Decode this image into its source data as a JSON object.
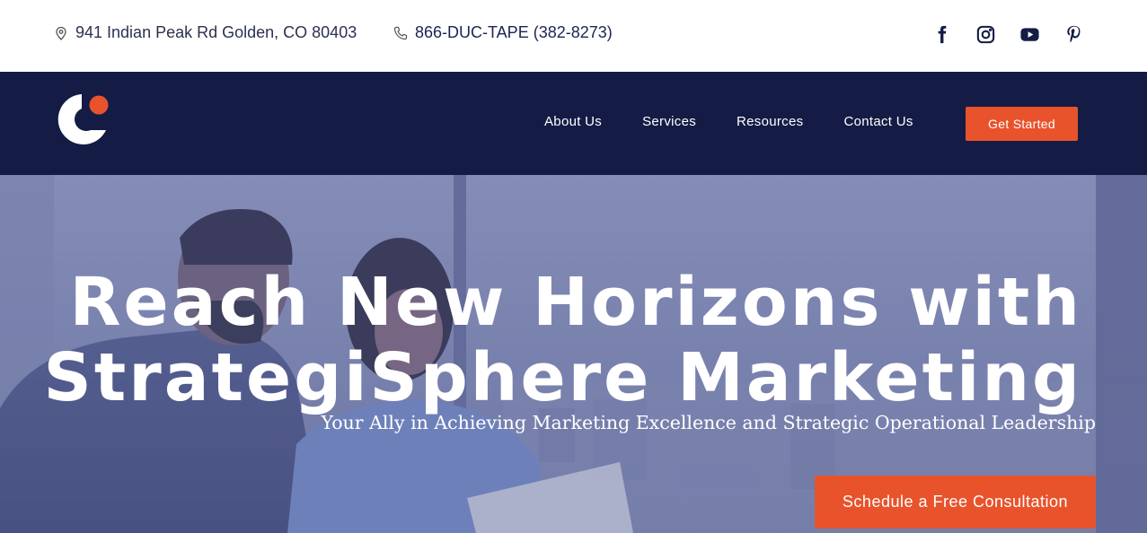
{
  "topbar": {
    "address_icon": "location-pin-icon",
    "address": "941 Indian Peak Rd Golden, CO 80403",
    "phone_icon": "phone-icon",
    "phone": "866-DUC-TAPE (382-8273)",
    "socials": [
      "facebook-icon",
      "instagram-icon",
      "youtube-icon",
      "pinterest-icon"
    ]
  },
  "nav": {
    "logo": "strategisphere-logo",
    "items": [
      {
        "label": "About Us"
      },
      {
        "label": "Services"
      },
      {
        "label": "Resources"
      },
      {
        "label": "Contact Us"
      }
    ],
    "cta_label": "Get Started"
  },
  "hero": {
    "title_line1": "Reach New Horizons with",
    "title_line2": "StrategiSphere Marketing",
    "subtitle": "Your Ally in Achieving Marketing Excellence and Strategic Operational Leadership",
    "cta_label": "Schedule a Free Consultation"
  },
  "colors": {
    "navy": "#141c45",
    "accent": "#e8532c",
    "hero_overlay": "#6d76a4"
  }
}
